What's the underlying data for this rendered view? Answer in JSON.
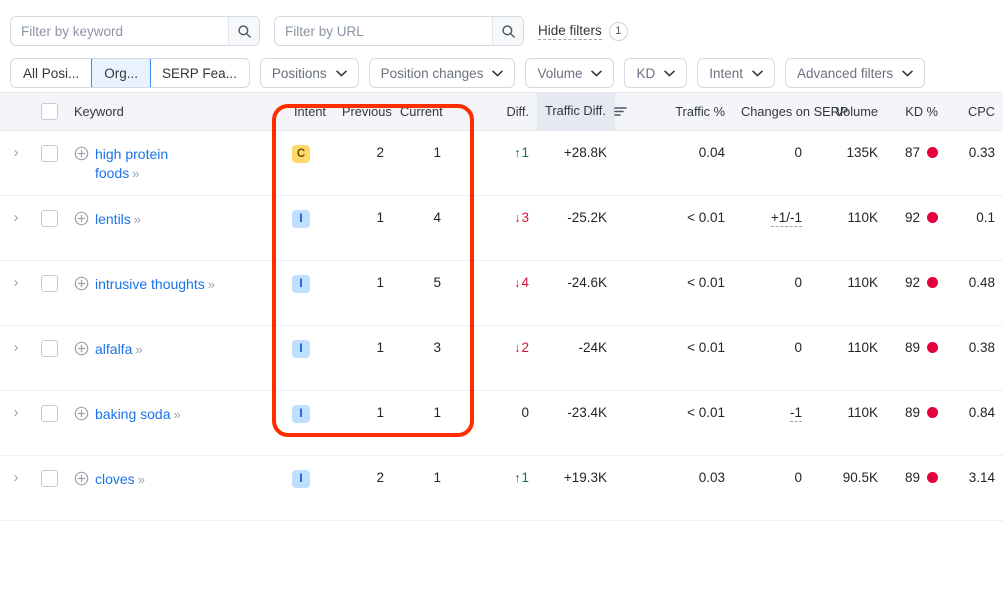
{
  "search": {
    "keyword_placeholder": "Filter by keyword",
    "keyword_value": "",
    "url_placeholder": "Filter by URL",
    "url_value": "",
    "hide_filters_label": "Hide filters",
    "filters_count": "1"
  },
  "segmented": {
    "items": [
      {
        "label": "All Posi...",
        "active": false
      },
      {
        "label": "Org...",
        "active": true
      },
      {
        "label": "SERP Fea...",
        "active": false
      }
    ]
  },
  "chips": [
    {
      "label": "Positions"
    },
    {
      "label": "Position changes"
    },
    {
      "label": "Volume"
    },
    {
      "label": "KD"
    },
    {
      "label": "Intent"
    },
    {
      "label": "Advanced filters"
    }
  ],
  "table": {
    "headers": {
      "keyword": "Keyword",
      "intent": "Intent",
      "previous": "Previous",
      "current": "Current",
      "diff": "Diff.",
      "traffic_diff": "Traffic Diff.",
      "traffic_pct": "Traffic %",
      "changes_serp": "Changes on SERP",
      "volume": "Volume",
      "kd": "KD %",
      "cpc": "CPC"
    },
    "sorted_column": "traffic_diff",
    "rows": [
      {
        "keyword": "high protein foods",
        "intent": "C",
        "previous": "2",
        "current": "1",
        "diff": "1",
        "diff_dir": "up",
        "traffic_diff": "+28.8K",
        "traffic_pct": "0.04",
        "changes_serp": "0",
        "changes_serp_dashed": false,
        "volume": "135K",
        "kd": "87",
        "kd_color": "#e3003c",
        "cpc": "0.33"
      },
      {
        "keyword": "lentils",
        "intent": "I",
        "previous": "1",
        "current": "4",
        "diff": "3",
        "diff_dir": "down",
        "traffic_diff": "-25.2K",
        "traffic_pct": "< 0.01",
        "changes_serp": "+1/-1",
        "changes_serp_dashed": true,
        "volume": "110K",
        "kd": "92",
        "kd_color": "#e3003c",
        "cpc": "0.1"
      },
      {
        "keyword": "intrusive thoughts",
        "intent": "I",
        "previous": "1",
        "current": "5",
        "diff": "4",
        "diff_dir": "down",
        "traffic_diff": "-24.6K",
        "traffic_pct": "< 0.01",
        "changes_serp": "0",
        "changes_serp_dashed": false,
        "volume": "110K",
        "kd": "92",
        "kd_color": "#e3003c",
        "cpc": "0.48"
      },
      {
        "keyword": "alfalfa",
        "intent": "I",
        "previous": "1",
        "current": "3",
        "diff": "2",
        "diff_dir": "down",
        "traffic_diff": "-24K",
        "traffic_pct": "< 0.01",
        "changes_serp": "0",
        "changes_serp_dashed": false,
        "volume": "110K",
        "kd": "89",
        "kd_color": "#e3003c",
        "cpc": "0.38"
      },
      {
        "keyword": "baking soda",
        "intent": "I",
        "previous": "1",
        "current": "1",
        "diff": "0",
        "diff_dir": "none",
        "traffic_diff": "-23.4K",
        "traffic_pct": "< 0.01",
        "changes_serp": "-1",
        "changes_serp_dashed": true,
        "volume": "110K",
        "kd": "89",
        "kd_color": "#e3003c",
        "cpc": "0.84"
      },
      {
        "keyword": "cloves",
        "intent": "I",
        "previous": "2",
        "current": "1",
        "diff": "1",
        "diff_dir": "up",
        "traffic_diff": "+19.3K",
        "traffic_pct": "0.03",
        "changes_serp": "0",
        "changes_serp_dashed": false,
        "volume": "90.5K",
        "kd": "89",
        "kd_color": "#e3003c",
        "cpc": "3.14"
      }
    ]
  },
  "annotation": {
    "color": "#ff2d00",
    "covers": "Previous, Current and Diff. columns"
  }
}
